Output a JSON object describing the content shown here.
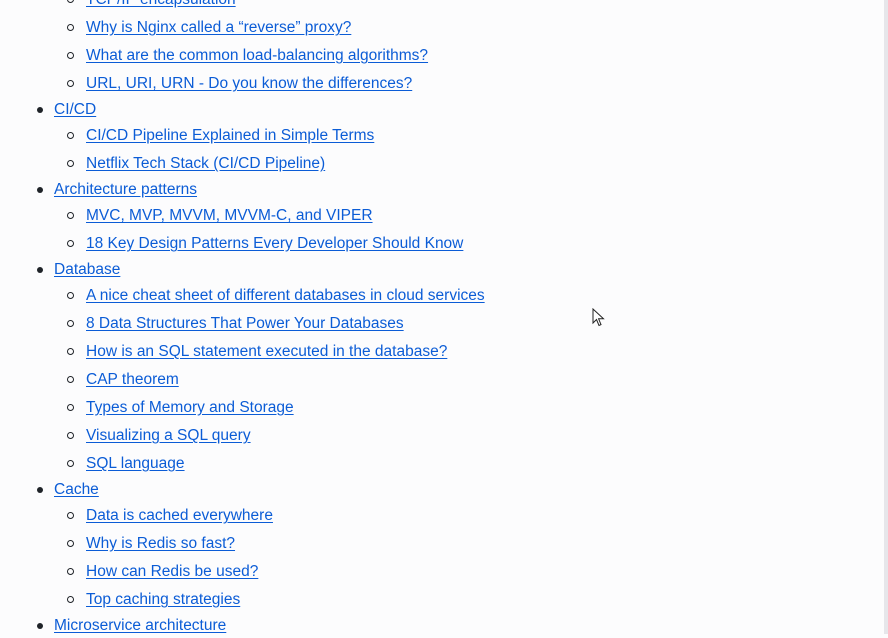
{
  "sections": [
    {
      "title": "",
      "items": [
        "TCP/IP encapsulation",
        "Why is Nginx called a “reverse” proxy?",
        "What are the common load-balancing algorithms?",
        "URL, URI, URN - Do you know the differences?"
      ]
    },
    {
      "title": "CI/CD",
      "items": [
        "CI/CD Pipeline Explained in Simple Terms",
        "Netflix Tech Stack (CI/CD Pipeline)"
      ]
    },
    {
      "title": "Architecture patterns",
      "items": [
        "MVC, MVP, MVVM, MVVM-C, and VIPER",
        "18 Key Design Patterns Every Developer Should Know"
      ]
    },
    {
      "title": "Database",
      "items": [
        "A nice cheat sheet of different databases in cloud services",
        "8 Data Structures That Power Your Databases",
        "How is an SQL statement executed in the database?",
        "CAP theorem",
        "Types of Memory and Storage",
        "Visualizing a SQL query",
        "SQL language"
      ]
    },
    {
      "title": "Cache",
      "items": [
        "Data is cached everywhere",
        "Why is Redis so fast?",
        "How can Redis be used?",
        "Top caching strategies"
      ]
    },
    {
      "title": "Microservice architecture",
      "items": []
    }
  ]
}
